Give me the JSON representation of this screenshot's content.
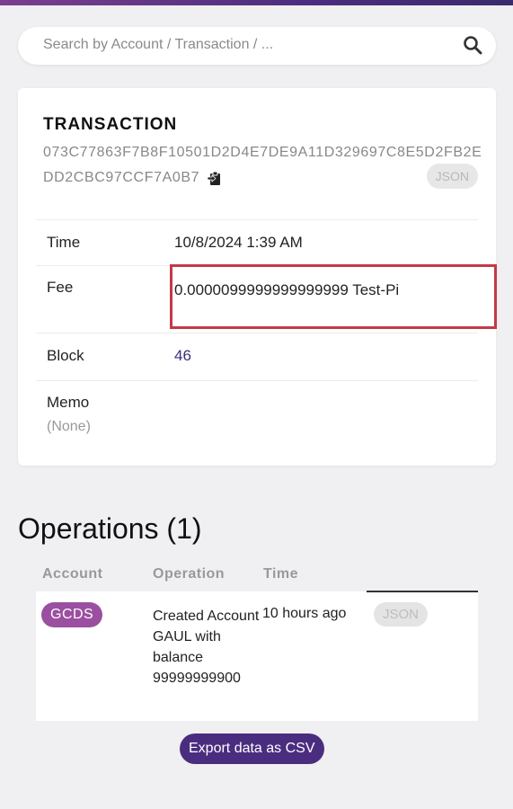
{
  "search": {
    "placeholder": "Search by Account / Transaction / ..."
  },
  "transaction": {
    "title": "TRANSACTION",
    "hash": "073C77863F7B8F10501D2D4E7DE9A11D329697C8E5D2FB2EDD2CBC97CCF7A0B7",
    "json_label": "JSON",
    "rows": {
      "time": {
        "label": "Time",
        "value": "10/8/2024 1:39 AM"
      },
      "fee": {
        "label": "Fee",
        "value": "0.0000099999999999999 Test-Pi"
      },
      "block": {
        "label": "Block",
        "value": "46"
      },
      "memo": {
        "label": "Memo",
        "value": "(None)"
      }
    }
  },
  "operations": {
    "title": "Operations (1)",
    "headers": {
      "account": "Account",
      "operation": "Operation",
      "time": "Time"
    },
    "items": [
      {
        "account": "GCDS",
        "operation": "Created Account GAUL with balance 99999999900",
        "time": "10 hours ago",
        "json_label": "JSON"
      }
    ],
    "export_label": "Export data as CSV"
  },
  "colors": {
    "accent": "#4b2d7f",
    "account_pill": "#9b4fa0",
    "highlight_box": "#c23a47"
  },
  "icons": {
    "search": "search-icon",
    "copy": "clipboard-icon"
  }
}
